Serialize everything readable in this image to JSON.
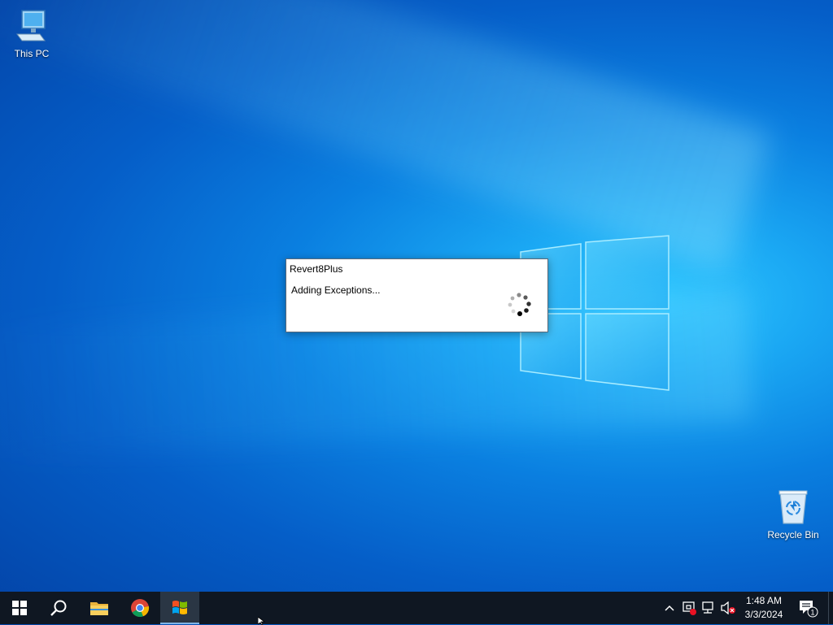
{
  "desktop": {
    "icons": [
      {
        "label": "This PC",
        "icon": "computer-icon"
      },
      {
        "label": "Recycle Bin",
        "icon": "recycle-bin-icon"
      }
    ]
  },
  "dialog": {
    "title": "Revert8Plus",
    "message": "Adding Exceptions..."
  },
  "taskbar": {
    "apps": [
      {
        "name": "Start",
        "icon": "windows-start-icon"
      },
      {
        "name": "Search",
        "icon": "search-icon"
      },
      {
        "name": "File Explorer",
        "icon": "folder-icon"
      },
      {
        "name": "Google Chrome",
        "icon": "chrome-icon"
      },
      {
        "name": "Revert8Plus",
        "icon": "windows-flag-icon",
        "active": true
      }
    ],
    "tray": {
      "time": "1:48 AM",
      "date": "3/3/2024",
      "notification_count": "1"
    }
  },
  "colors": {
    "taskbar": "#0f1722",
    "desktop_accent": "#0a7fe0"
  }
}
